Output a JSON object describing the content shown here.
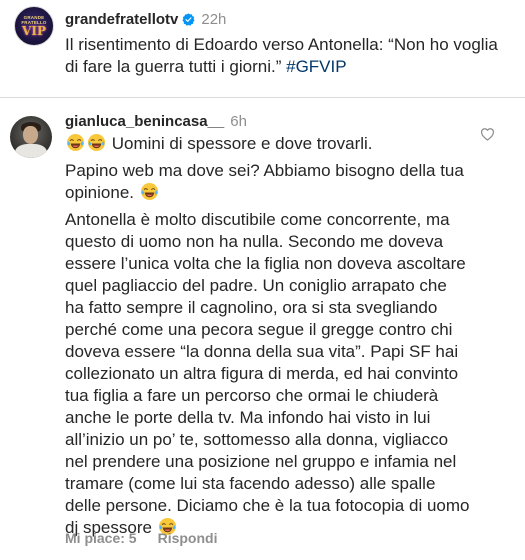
{
  "caption": {
    "avatar_text_top": "GRANDE FRATELLO",
    "avatar_text_vip": "VIP",
    "username": "grandefratellotv",
    "verified_icon": "verified-badge-icon",
    "time": "22h",
    "text": "Il risentimento di Edoardo verso Antonella: “Non ho voglia di fare la guerra tutti i giorni.” ",
    "hashtag": "#GFVIP"
  },
  "comment": {
    "username": "gianluca_benincasa__",
    "time": "6h",
    "like_icon": "heart-outline-icon",
    "paragraphs": [
      {
        "emoji_prefix": "tears-of-joy-emoji tears-of-joy-emoji",
        "text": " Uomini di spessore e dove trovarli."
      },
      {
        "text": "Papino web ma dove sei? Abbiamo bisogno della tua opinione. ",
        "emoji_suffix": "tears-of-joy-emoji"
      },
      {
        "text": "Antonella è molto discutibile come concorrente, ma questo di uomo non ha nulla. Secondo me doveva essere l’unica volta che la figlia non doveva ascoltare quel pagliaccio del padre. Un coniglio arrapato che ha fatto sempre il cagnolino, ora si sta svegliando perché come una pecora segue il gregge contro chi doveva essere “la donna della sua vita”. Papi SF hai collezionato un altra figura di merda, ed hai convinto tua figlia a fare un percorso che ormai le chiuderà anche le porte della tv. Ma infondo hai visto in lui all’inizio un po’ te, sottomesso alla donna, vigliacco nel prendere una posizione nel gruppo e infamia nel tramare (come lui sta facendo adesso)  alle spalle delle persone. Diciamo che è la tua fotocopia di uomo dj spessore ",
        "emoji_suffix": "tears-of-joy-emoji"
      }
    ],
    "likes_label": "Mi piace: 5",
    "reply_label": "Rispondi"
  },
  "colors": {
    "text": "#262626",
    "secondary": "#8e8e8e",
    "hashtag": "#00376b",
    "verified": "#0095f6",
    "divider": "#dbdbdb"
  }
}
